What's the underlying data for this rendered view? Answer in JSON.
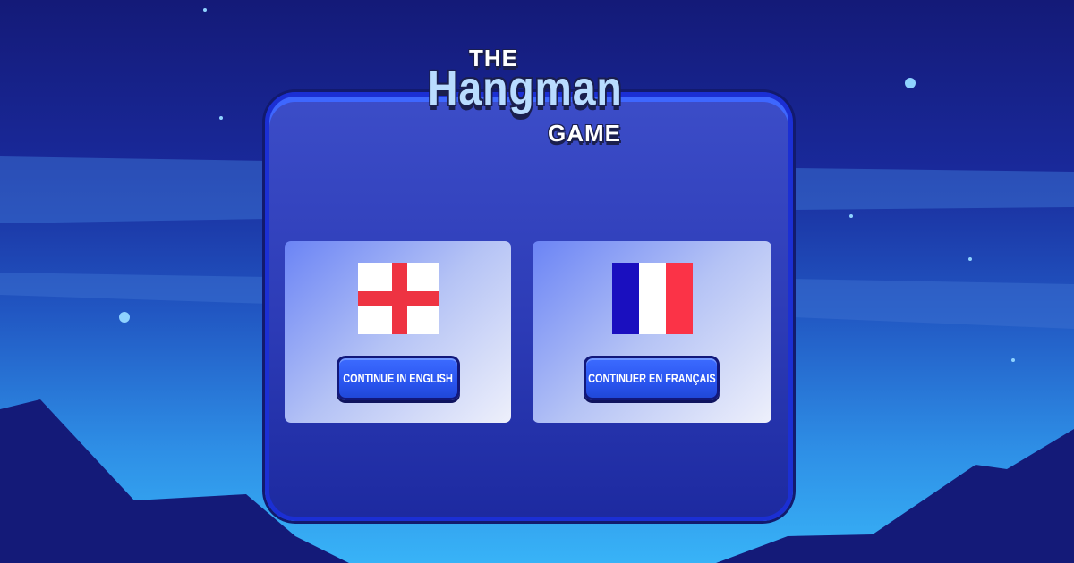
{
  "title": {
    "the": "THE",
    "main": "Hangman",
    "game": "GAME"
  },
  "languages": [
    {
      "id": "english",
      "flag": "england-flag-icon",
      "button_label": "CONTINUE IN ENGLISH"
    },
    {
      "id": "french",
      "flag": "france-flag-icon",
      "button_label": "CONTINUER EN FRANÇAIS"
    }
  ],
  "colors": {
    "accent": "#2a55f0",
    "panel": "#2c3bb6",
    "england_red": "#ee3342",
    "france_blue": "#1a0fbf",
    "france_red": "#fb3347"
  }
}
